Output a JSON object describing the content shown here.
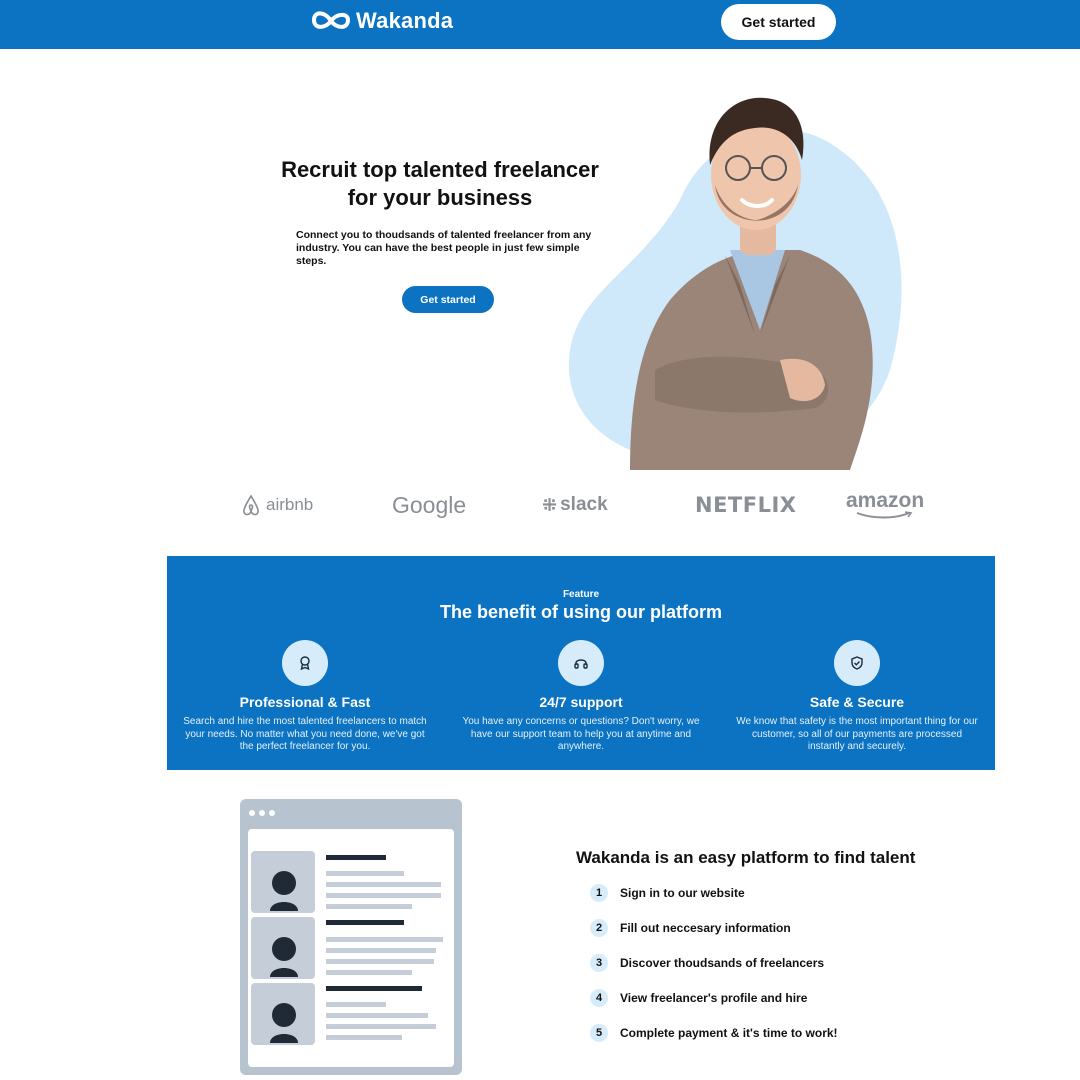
{
  "header": {
    "brand_name": "Wakanda",
    "cta_label": "Get started"
  },
  "hero": {
    "title": "Recruit top talented freelancer for your business",
    "description": "Connect you to thoudsands of talented freelancer from any industry. You can have the best people in just few simple steps.",
    "cta_label": "Get started"
  },
  "brands": [
    "airbnb",
    "Google",
    "slack",
    "NETFLIX",
    "amazon"
  ],
  "features": {
    "eyebrow": "Feature",
    "title": "The benefit of using our platform",
    "items": [
      {
        "icon": "award-icon",
        "name": "Professional & Fast",
        "text": "Search and hire the most talented freelancers to match your needs. No matter what you need done, we've got the perfect freelancer for you."
      },
      {
        "icon": "headset-icon",
        "name": "24/7 support",
        "text": "You have any concerns or questions? Don't worry, we have our support team to help you at anytime and anywhere."
      },
      {
        "icon": "shield-check-icon",
        "name": "Safe & Secure",
        "text": "We know that safety is the most important thing for our customer, so all of our payments are processed instantly and securely."
      }
    ]
  },
  "steps": {
    "title": "Wakanda is an easy platform to find talent",
    "items": [
      {
        "num": "1",
        "label": "Sign in to our website"
      },
      {
        "num": "2",
        "label": "Fill out neccesary information"
      },
      {
        "num": "3",
        "label": "Discover thoudsands of freelancers"
      },
      {
        "num": "4",
        "label": "View freelancer's profile and hire"
      },
      {
        "num": "5",
        "label": "Complete payment & it's time to work!"
      }
    ]
  },
  "colors": {
    "primary": "#0b73c1",
    "icon_circle": "#d7ecfb",
    "hero_blob": "#cfe9fb",
    "brand_gray": "#8a8f95",
    "mock_frame": "#b7c3cf"
  }
}
